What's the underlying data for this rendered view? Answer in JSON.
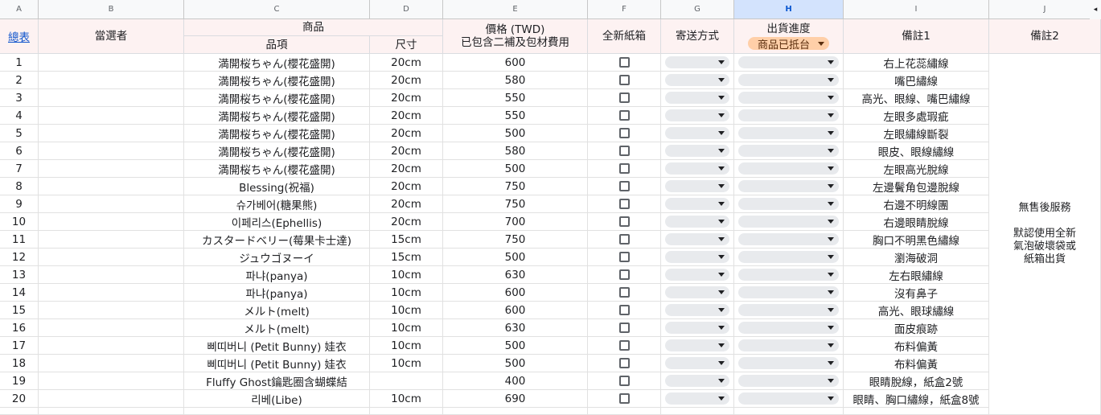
{
  "columns": [
    "A",
    "B",
    "C",
    "D",
    "E",
    "F",
    "G",
    "H",
    "I",
    "J"
  ],
  "selected_column": "H",
  "header": {
    "summary_link": "總表",
    "winner": "當選者",
    "product_group": "商品",
    "item": "品項",
    "size": "尺寸",
    "price_line1": "價格 (TWD)",
    "price_line2": "已包含二補及包材費用",
    "new_box": "全新紙箱",
    "shipping": "寄送方式",
    "shipping_progress": "出貨進度",
    "progress_chip": "商品已抵台",
    "note1": "備註1",
    "note2": "備註2"
  },
  "rows": [
    {
      "num": "1",
      "item": "満開桜ちゃん(櫻花盛開)",
      "size": "20cm",
      "price": "600",
      "note": "右上花蕊繡線"
    },
    {
      "num": "2",
      "item": "満開桜ちゃん(櫻花盛開)",
      "size": "20cm",
      "price": "580",
      "note": "嘴巴繡線"
    },
    {
      "num": "3",
      "item": "満開桜ちゃん(櫻花盛開)",
      "size": "20cm",
      "price": "550",
      "note": "高光、眼線、嘴巴繡線"
    },
    {
      "num": "4",
      "item": "満開桜ちゃん(櫻花盛開)",
      "size": "20cm",
      "price": "550",
      "note": "左眼多處瑕疵"
    },
    {
      "num": "5",
      "item": "満開桜ちゃん(櫻花盛開)",
      "size": "20cm",
      "price": "500",
      "note": "左眼繡線斷裂"
    },
    {
      "num": "6",
      "item": "満開桜ちゃん(櫻花盛開)",
      "size": "20cm",
      "price": "580",
      "note": "眼皮、眼線繡線"
    },
    {
      "num": "7",
      "item": "満開桜ちゃん(櫻花盛開)",
      "size": "20cm",
      "price": "500",
      "note": "左眼高光脫線"
    },
    {
      "num": "8",
      "item": "Blessing(祝福)",
      "size": "20cm",
      "price": "750",
      "note": "左邊鬢角包邊脫線"
    },
    {
      "num": "9",
      "item": "슈가베어(糖果熊)",
      "size": "20cm",
      "price": "750",
      "note": "右邊不明線團"
    },
    {
      "num": "10",
      "item": "이페리스(Ephellis)",
      "size": "20cm",
      "price": "700",
      "note": "右邊眼睛脫線"
    },
    {
      "num": "11",
      "item": "カスタードベリー(莓果卡士達)",
      "size": "15cm",
      "price": "750",
      "note": "胸口不明黑色繡線"
    },
    {
      "num": "12",
      "item": "ジュウゴヌーイ",
      "size": "15cm",
      "price": "500",
      "note": "瀏海破洞"
    },
    {
      "num": "13",
      "item": "파냐(panya)",
      "size": "10cm",
      "price": "630",
      "note": "左右眼繡線"
    },
    {
      "num": "14",
      "item": "파냐(panya)",
      "size": "10cm",
      "price": "600",
      "note": "沒有鼻子"
    },
    {
      "num": "15",
      "item": "メルト(melt)",
      "size": "10cm",
      "price": "600",
      "note": "高光、眼球繡線"
    },
    {
      "num": "16",
      "item": "メルト(melt)",
      "size": "10cm",
      "price": "630",
      "note": "面皮痕跡"
    },
    {
      "num": "17",
      "item": "삐띠버니 (Petit Bunny) 娃衣",
      "size": "10cm",
      "price": "500",
      "note": "布料偏黃"
    },
    {
      "num": "18",
      "item": "삐띠버니 (Petit Bunny) 娃衣",
      "size": "10cm",
      "price": "500",
      "note": "布料偏黃"
    },
    {
      "num": "19",
      "item": "Fluffy Ghost鑰匙圈含蝴蝶結",
      "size": "",
      "price": "400",
      "note": "眼睛脫線，紙盒2號"
    },
    {
      "num": "20",
      "item": "리베(Libe)",
      "size": "10cm",
      "price": "690",
      "note": "眼睛、胸口繡線，紙盒8號"
    }
  ],
  "note2_text": "無售後服務\n\n默認使用全新\n氣泡破壞袋或\n紙箱出貨",
  "colors": {
    "header_bg": "#fdf2f2",
    "chip_bg": "#ffcfa8",
    "link": "#1155cc",
    "selected_col_header": "#d3e3fd"
  }
}
